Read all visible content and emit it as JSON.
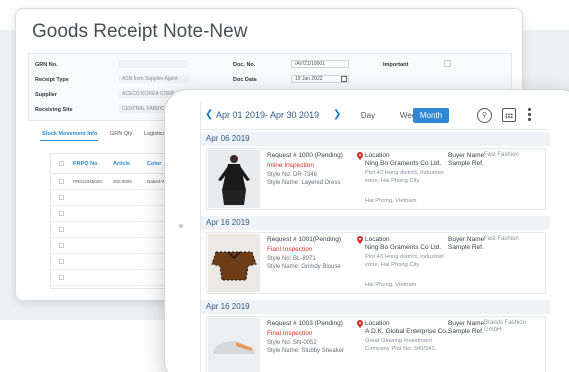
{
  "grn": {
    "title": "Goods Receipt Note-New",
    "fields": {
      "grn_no_label": "GRN No.",
      "receipt_type_label": "Receipt Type",
      "receipt_type_value": "ASN from Supplier Agent",
      "supplier_label": "Supplier",
      "supplier_value": "ACECO KOREA CORP",
      "receiving_site_label": "Receiving Site",
      "receiving_site_value": "CENTRAL FABRIC WA",
      "doc_no_label": "Doc. No.",
      "doc_no_value": "/AV/21/10001",
      "doc_date_label": "Doc Date",
      "doc_date_value": "19 Jan 2022",
      "important_label": "Important"
    },
    "tabs": [
      "Stock Movement Info",
      "GRN Qty",
      "Logistics"
    ],
    "grid": {
      "headers": [
        "PRPO No",
        "Article",
        "Color"
      ],
      "first_row": [
        "PR012345020",
        "300.0000",
        "Naked-Wi..."
      ]
    }
  },
  "calendar": {
    "range": "Apr 01 2019- Apr 30 2019",
    "views": [
      "Day",
      "Week",
      "Month"
    ],
    "active_view": "Month",
    "groups": [
      {
        "date": "Apr 06 2019",
        "request": "Request # 1000 (Pending)",
        "inspection": "Inline Inspection",
        "style_no": "Style No: DR-7346",
        "style_name": "Style Name: Layered Dress",
        "location_label": "Location",
        "location_name": "Ning Bo Graments Co Ltd.",
        "address": "Plot 43 Hong district, Industriel zone, Hai Phong City",
        "city": "Hai Phong, Vietnam",
        "buyer_label": "Buyer Name",
        "buyer_value": "Fast Fashion",
        "sample_ref": "Sample Ref."
      },
      {
        "date": "Apr 16 2019",
        "request": "Request # 1001(Pending)",
        "inspection": "Fianl Inspection",
        "style_no": "Style No: BL-8971",
        "style_name": "Style Name: Grimdy Blouse",
        "location_label": "Location",
        "location_name": "Ning Bo Graments Co Ltd.",
        "address": "Plot 43 Hong district, Industriel zone, Hai Phong City",
        "city": "Hai Phong, Vietnam",
        "buyer_label": "Buyer Name",
        "buyer_value": "Fast Fashion",
        "sample_ref": "Sample Ref."
      },
      {
        "date": "Apr 16 2019",
        "request": "Request # 1003 (Pending)",
        "inspection": "Final Inspection",
        "style_no": "Style No: SN-0052",
        "style_name": "Style Name: Stubby Sneaker",
        "location_label": "Location",
        "location_name": "A.D.K. Global Enterprise Co...",
        "address": "Great Glowing Investment Company Plot No: 340/341,",
        "city": "",
        "buyer_label": "Buyer Name",
        "buyer_value": "Brands Fashion GmbH",
        "sample_ref": "Sample Ref."
      }
    ]
  }
}
